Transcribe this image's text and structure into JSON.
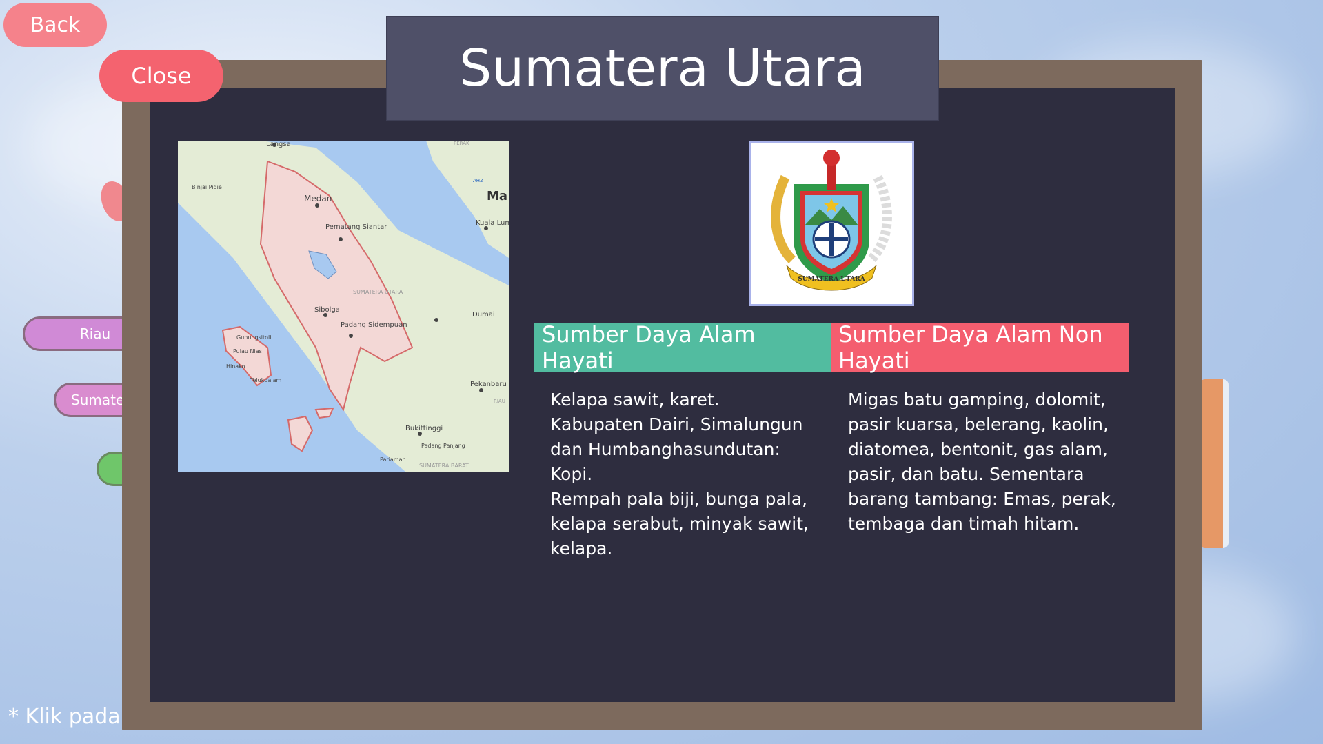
{
  "header": {
    "back_label": "Back",
    "close_label": "Close",
    "title": "Sumatera Utara"
  },
  "side_menu": {
    "items": [
      {
        "label": "Riau"
      },
      {
        "label": "Sumater"
      },
      {
        "label": ""
      }
    ]
  },
  "footnote": "* Klik pada d",
  "map": {
    "labels": [
      "Langsa",
      "Medan",
      "Binjai Pidie",
      "Pematang Siantar",
      "SUMATERA UTARA",
      "Sibolga",
      "Padang Sidempuan",
      "Gunungsitoli",
      "Pulau Nias",
      "Hinako",
      "Telukdalam",
      "Dumai",
      "Pekanbaru",
      "Bukittinggi",
      "Padang Panjang",
      "Pariaman",
      "SUMATERA BARAT",
      "Kuala Lum",
      "Ma",
      "AH2",
      "RIAU",
      "PERAK"
    ]
  },
  "logo": {
    "icon": "province-emblem-icon",
    "ribbon_text": "SUMATERA UTARA"
  },
  "tabs": {
    "hayati_label": "Sumber Daya Alam Hayati",
    "non_hayati_label": "Sumber Daya Alam Non Hayati"
  },
  "content": {
    "hayati_text": "Kelapa sawit, karet.\nKabupaten Dairi, Simalungun dan Humbanghasundutan: Kopi.\nRempah pala biji, bunga pala, kelapa serabut, minyak sawit, kelapa.",
    "non_hayati_text": "Migas batu gamping, dolomit, pasir kuarsa, belerang, kaolin, diatomea, bentonit, gas alam, pasir, dan batu. Sementara barang tambang: Emas, perak, tembaga dan timah hitam."
  },
  "colors": {
    "board": "#2e2d3f",
    "frame": "#7d6a5d",
    "banner": "#4f5068",
    "button_red": "#f4636f",
    "tab_green": "#52bca0",
    "tab_red": "#f45e6f"
  }
}
